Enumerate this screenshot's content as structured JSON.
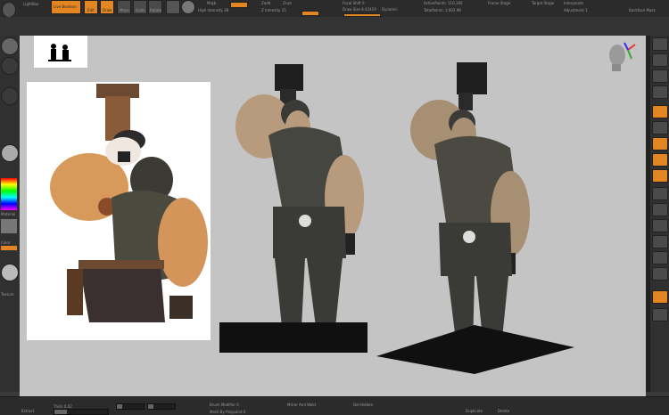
{
  "topbar": {
    "lightbox_label": "LightBox",
    "live_boolean_label": "Live Boolean",
    "edit_label": "Edit",
    "draw_label": "Draw",
    "move_label": "Move",
    "scale_label": "Scale",
    "rotate_label": "Rotate",
    "mrgb_label": "Mrgb",
    "rgb_label": "Rgb",
    "m_label": "M",
    "zadd_label": "Zadd",
    "zsub_label": "Zsub",
    "zcut_label": "Zcut",
    "focal_shift_label": "Focal Shift 0",
    "draw_size_label": "Draw Size 8.42419",
    "dynamic_label": "Dynamic",
    "active_points_label": "ActivePoints: 110,160",
    "total_points_label": "TotalPoints: 1.003 Mil",
    "intensity_label": "Rgb Intensity 100",
    "z_intensity_label": "Z Intensity 25",
    "hi_intensity_label": "High Intensity 38",
    "frame_label": "Frame Stage",
    "target_stage_label": "Target Stage",
    "interpolate_label": "Interpolate",
    "adjustment_label": "Adjustment 1",
    "backface_label": "Backface Mask"
  },
  "bottombar": {
    "extract_label": "Extract",
    "thick_label": "Thick 0.02",
    "brush_modifier_label": "Brush Modifier 0",
    "mesh_subdiv_label": "Mesh By Polypaint 0",
    "mirror_weld_label": "Mirror And Weld",
    "del_hidden_label": "Del Hidden",
    "duplicate_label": "Duplicate",
    "delete_label": "Delete"
  },
  "left_shelf": {
    "color_label": "Color",
    "texture_label": "Texture",
    "material_label": "Material"
  },
  "colors": {
    "accent": "#e38521",
    "canvas": "#c4c4c4",
    "panel": "#303030"
  }
}
